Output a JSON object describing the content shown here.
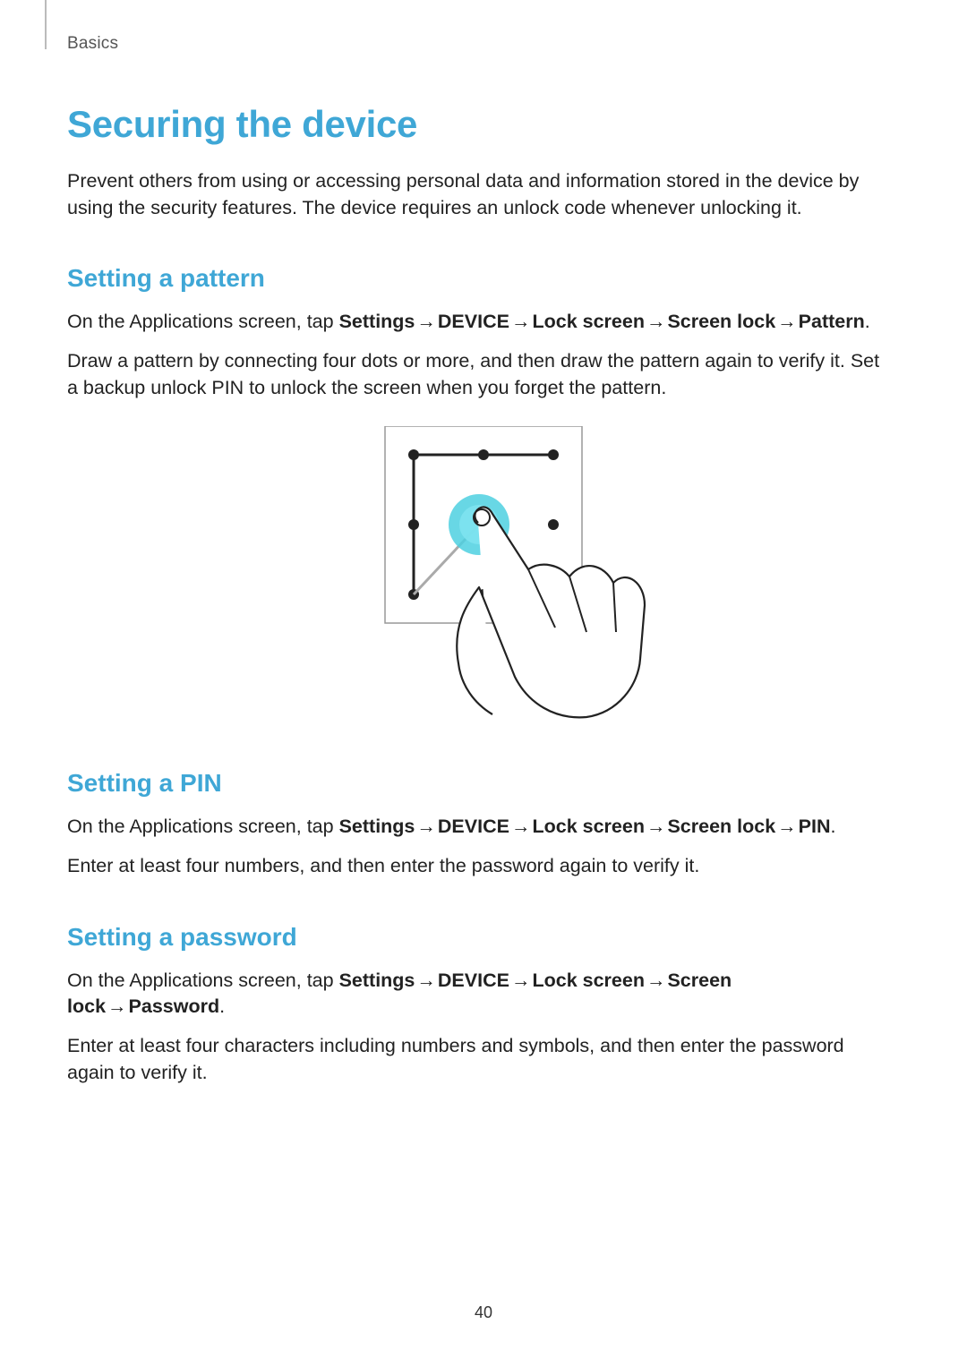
{
  "breadcrumb": "Basics",
  "title": "Securing the device",
  "intro": "Prevent others from using or accessing personal data and information stored in the device by using the security features. The device requires an unlock code whenever unlocking it.",
  "pattern": {
    "heading": "Setting a pattern",
    "path_pre": "On the Applications screen, tap ",
    "settings": "Settings",
    "device": "DEVICE",
    "lockscreen": "Lock screen",
    "screenlock": "Screen lock",
    "last": "Pattern",
    "period": ".",
    "body": "Draw a pattern by connecting four dots or more, and then draw the pattern again to verify it. Set a backup unlock PIN to unlock the screen when you forget the pattern."
  },
  "pin": {
    "heading": "Setting a PIN",
    "path_pre": "On the Applications screen, tap ",
    "settings": "Settings",
    "device": "DEVICE",
    "lockscreen": "Lock screen",
    "screenlock": "Screen lock",
    "last": "PIN",
    "period": ".",
    "body": "Enter at least four numbers, and then enter the password again to verify it."
  },
  "password": {
    "heading": "Setting a password",
    "path_pre": "On the Applications screen, tap ",
    "settings": "Settings",
    "device": "DEVICE",
    "lockscreen": "Lock screen",
    "screenlock": "Screen lock",
    "last": "Password",
    "period": ".",
    "body": "Enter at least four characters including numbers and symbols, and then enter the password again to verify it."
  },
  "arrow": "→",
  "page_number": "40"
}
